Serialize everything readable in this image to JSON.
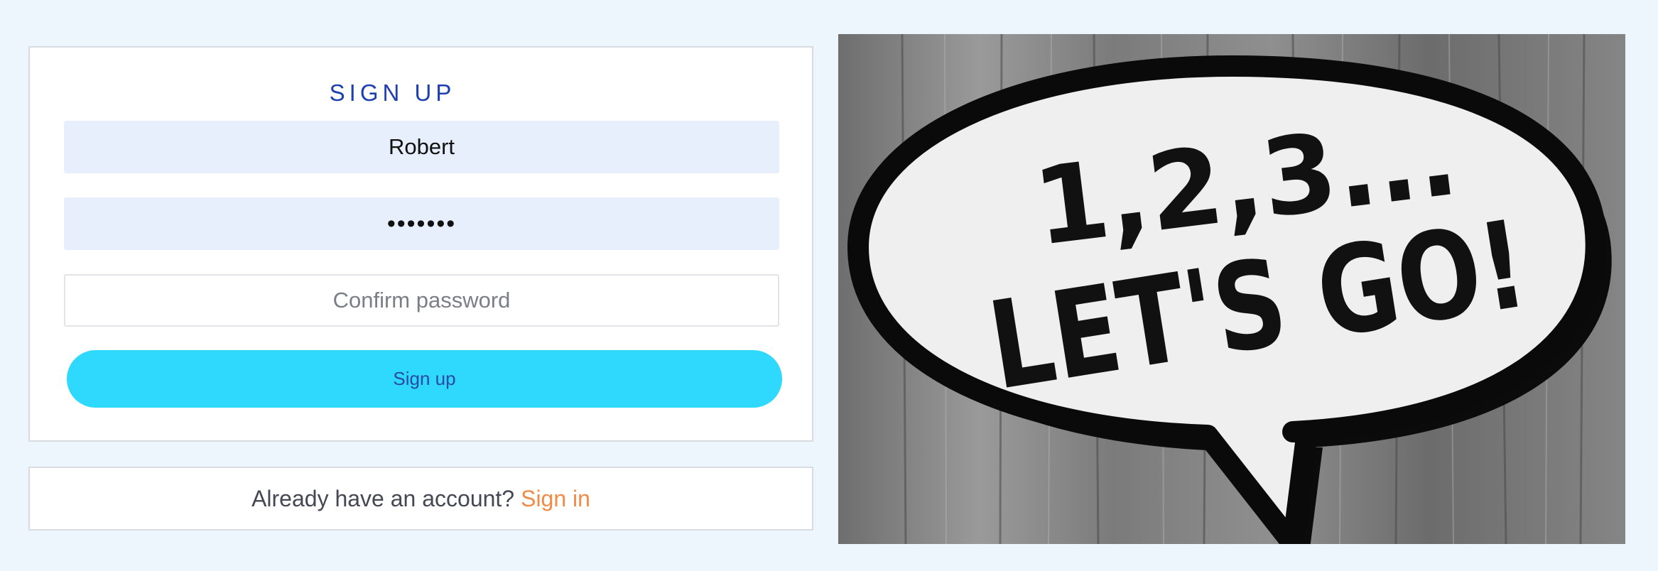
{
  "signup": {
    "title": "SIGN UP",
    "username_value": "Robert",
    "password_value": "•••••••",
    "confirm_placeholder": "Confirm password",
    "submit_label": "Sign up"
  },
  "signin": {
    "question": "Already have an account?",
    "link_label": "Sign in"
  },
  "hero": {
    "line1": "1,2,3...",
    "line2": "LET'S GO!"
  },
  "colors": {
    "background": "#eef6fd",
    "title": "#1e3fb0",
    "button": "#2ed9fd",
    "link": "#f28b45",
    "input_fill": "#e8effc"
  }
}
